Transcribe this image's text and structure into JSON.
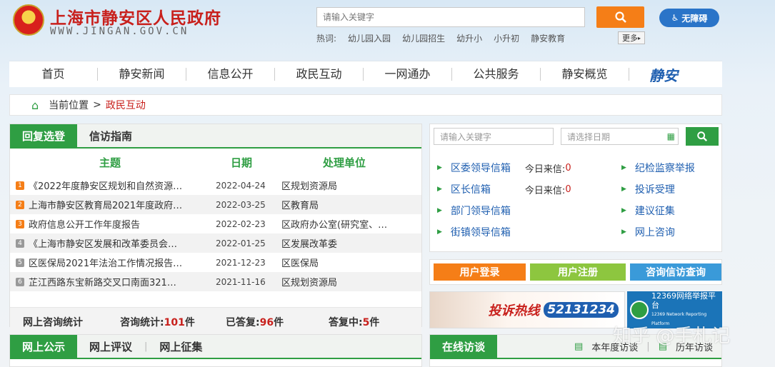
{
  "header": {
    "title": "上海市静安区人民政府",
    "domain": "WWW.JINGAN.GOV.CN",
    "search_placeholder": "请输入关键字",
    "accessibility": "无障碍",
    "hot_label": "热词:",
    "hot_words": [
      "幼儿园入园",
      "幼儿园招生",
      "幼升小",
      "小升初",
      "静安教育"
    ],
    "more": "更多"
  },
  "nav": {
    "items": [
      "首页",
      "静安新闻",
      "信息公开",
      "政民互动",
      "一网通办",
      "公共服务",
      "静安概览"
    ],
    "logo": "静安"
  },
  "breadcrumb": {
    "label": "当前位置",
    "current": "政民互动"
  },
  "reply": {
    "tabs": [
      "回复选登",
      "信访指南"
    ],
    "columns": [
      "主题",
      "日期",
      "处理单位"
    ],
    "rows": [
      {
        "n": "1",
        "title": "《2022年度静安区规划和自然资源…",
        "date": "2022-04-24",
        "unit": "区规划资源局"
      },
      {
        "n": "2",
        "title": "上海市静安区教育局2021年度政府…",
        "date": "2022-03-25",
        "unit": "区教育局"
      },
      {
        "n": "3",
        "title": "政府信息公开工作年度报告",
        "date": "2022-02-23",
        "unit": "区政府办公室(研究室、…"
      },
      {
        "n": "4",
        "title": "《上海市静安区发展和改革委员会…",
        "date": "2022-01-25",
        "unit": "区发展改革委"
      },
      {
        "n": "5",
        "title": "区医保局2021年法治工作情况报告…",
        "date": "2021-12-23",
        "unit": "区医保局"
      },
      {
        "n": "6",
        "title": "芷江西路东宝新路交叉口南面321…",
        "date": "2021-11-16",
        "unit": "区规划资源局"
      }
    ],
    "stats": {
      "label": "网上咨询统计",
      "total_label": "咨询统计:",
      "total": "101",
      "replied_label": "已答复:",
      "replied": "96",
      "pending_label": "答复中:",
      "pending": "5",
      "unit": "件"
    }
  },
  "public": {
    "tabs": [
      "网上公示",
      "网上评议",
      "网上征集"
    ]
  },
  "letters": {
    "keyword_placeholder": "请输入关键字",
    "date_placeholder": "请选择日期",
    "left": [
      {
        "label": "区委领导信箱",
        "today": "今日来信:",
        "count": "0"
      },
      {
        "label": "区长信箱",
        "today": "今日来信:",
        "count": "0"
      },
      {
        "label": "部门领导信箱"
      },
      {
        "label": "街镇领导信箱"
      }
    ],
    "right": [
      "纪检监察举报",
      "投诉受理",
      "建议征集",
      "网上咨询"
    ]
  },
  "buttons": {
    "login": "用户登录",
    "register": "用户注册",
    "query": "咨询信访查询"
  },
  "banner": {
    "hotline_label": "投诉热线",
    "hotline": "52131234",
    "platform": "12369网络举报平台",
    "platform_en": "12369 Network Reporting Platform"
  },
  "visit": {
    "tab": "在线访谈",
    "this_year": "本年度访谈",
    "history": "历年访谈"
  },
  "watermark": "知乎 @手札记",
  "colors": {
    "green": "#2f9e43",
    "orange": "#f57e17",
    "red": "#c8201c",
    "blue": "#1f5fb0"
  }
}
